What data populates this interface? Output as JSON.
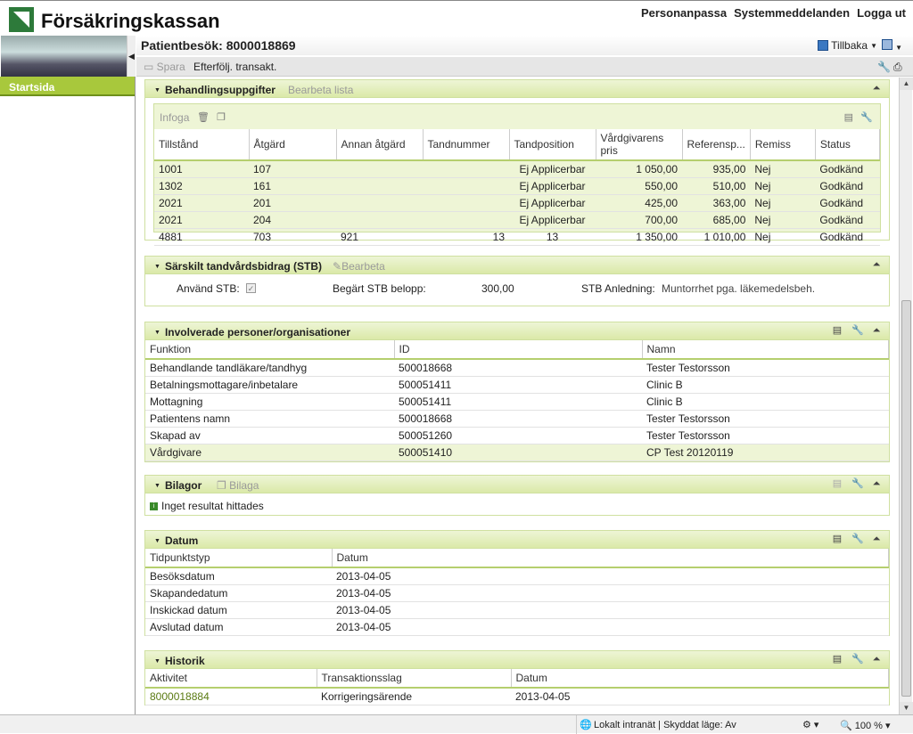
{
  "brand": "Försäkringskassan",
  "top_links": [
    "Personanpassa",
    "Systemmeddelanden",
    "Logga ut"
  ],
  "sidebar": {
    "items": [
      {
        "label": "Startsida"
      }
    ]
  },
  "header": {
    "title": "Patientbesök: 8000018869",
    "back_label": "Tillbaka"
  },
  "toolbar": {
    "save_label": "Spara",
    "follow_label": "Efterfölj. transakt."
  },
  "treatment": {
    "title": "Behandlingsuppgifter",
    "edit_label": "Bearbeta lista",
    "insert_label": "Infoga",
    "columns": [
      "Tillstånd",
      "Åtgärd",
      "Annan åtgärd",
      "Tandnummer",
      "Tandposition",
      "Vårdgivarens pris",
      "Referensp...",
      "Remiss",
      "Status"
    ],
    "rows": [
      [
        "1001",
        "107",
        "",
        "",
        "Ej Applicerbar",
        "1 050,00",
        "935,00",
        "Nej",
        "Godkänd"
      ],
      [
        "1302",
        "161",
        "",
        "",
        "Ej Applicerbar",
        "550,00",
        "510,00",
        "Nej",
        "Godkänd"
      ],
      [
        "2021",
        "201",
        "",
        "",
        "Ej Applicerbar",
        "425,00",
        "363,00",
        "Nej",
        "Godkänd"
      ],
      [
        "2021",
        "204",
        "",
        "",
        "Ej Applicerbar",
        "700,00",
        "685,00",
        "Nej",
        "Godkänd"
      ],
      [
        "4881",
        "703",
        "921",
        "13",
        "13",
        "1 350,00",
        "1 010,00",
        "Nej",
        "Godkänd"
      ]
    ]
  },
  "stb": {
    "title": "Särskilt tandvårdsbidrag (STB)",
    "edit_label": "Bearbeta",
    "use_label": "Använd STB:",
    "amount_label": "Begärt STB belopp:",
    "amount_value": "300,00",
    "reason_label": "STB Anledning:",
    "reason_value": "Muntorrhet pga. läkemedelsbeh."
  },
  "involved": {
    "title": "Involverade personer/organisationer",
    "columns": [
      "Funktion",
      "ID",
      "Namn"
    ],
    "rows": [
      [
        "Behandlande tandläkare/tandhyg",
        "500018668",
        "Tester Testorsson"
      ],
      [
        "Betalningsmottagare/inbetalare",
        "500051411",
        "Clinic B"
      ],
      [
        "Mottagning",
        "500051411",
        "Clinic B"
      ],
      [
        "Patientens namn",
        "500018668",
        "Tester Testorsson"
      ],
      [
        "Skapad av",
        "500051260",
        "Tester Testorsson"
      ],
      [
        "Vårdgivare",
        "500051410",
        "CP Test 20120119"
      ]
    ]
  },
  "attachments": {
    "title": "Bilagor",
    "add_label": "Bilaga",
    "empty_text": "Inget resultat hittades"
  },
  "dates": {
    "title": "Datum",
    "columns": [
      "Tidpunktstyp",
      "Datum"
    ],
    "rows": [
      [
        "Besöksdatum",
        "2013-04-05"
      ],
      [
        "Skapandedatum",
        "2013-04-05"
      ],
      [
        "Inskickad datum",
        "2013-04-05"
      ],
      [
        "Avslutad datum",
        "2013-04-05"
      ]
    ]
  },
  "history": {
    "title": "Historik",
    "columns": [
      "Aktivitet",
      "Transaktionsslag",
      "Datum"
    ],
    "rows": [
      [
        "8000018884",
        "Korrigeringsärende",
        "2013-04-05"
      ]
    ]
  },
  "statusbar": {
    "zone": "Lokalt intranät | Skyddat läge: Av",
    "zoom": "100 %"
  }
}
